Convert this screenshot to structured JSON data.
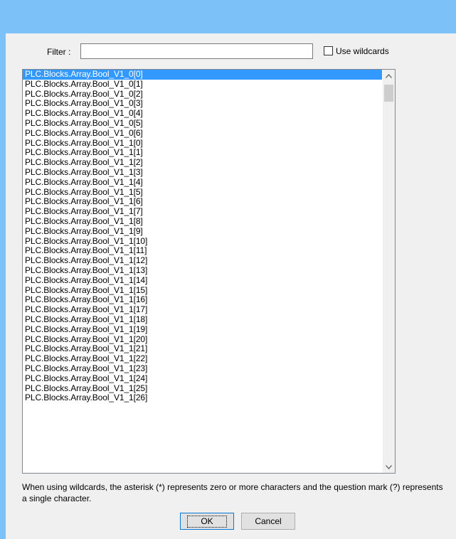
{
  "filter": {
    "label": "Filter :",
    "value": "",
    "placeholder": "",
    "wildcards_label": "Use wildcards",
    "wildcards_checked": false
  },
  "list": {
    "selected_index": 0,
    "items": [
      "PLC.Blocks.Array.Bool_V1_0[0]",
      "PLC.Blocks.Array.Bool_V1_0[1]",
      "PLC.Blocks.Array.Bool_V1_0[2]",
      "PLC.Blocks.Array.Bool_V1_0[3]",
      "PLC.Blocks.Array.Bool_V1_0[4]",
      "PLC.Blocks.Array.Bool_V1_0[5]",
      "PLC.Blocks.Array.Bool_V1_0[6]",
      "PLC.Blocks.Array.Bool_V1_1[0]",
      "PLC.Blocks.Array.Bool_V1_1[1]",
      "PLC.Blocks.Array.Bool_V1_1[2]",
      "PLC.Blocks.Array.Bool_V1_1[3]",
      "PLC.Blocks.Array.Bool_V1_1[4]",
      "PLC.Blocks.Array.Bool_V1_1[5]",
      "PLC.Blocks.Array.Bool_V1_1[6]",
      "PLC.Blocks.Array.Bool_V1_1[7]",
      "PLC.Blocks.Array.Bool_V1_1[8]",
      "PLC.Blocks.Array.Bool_V1_1[9]",
      "PLC.Blocks.Array.Bool_V1_1[10]",
      "PLC.Blocks.Array.Bool_V1_1[11]",
      "PLC.Blocks.Array.Bool_V1_1[12]",
      "PLC.Blocks.Array.Bool_V1_1[13]",
      "PLC.Blocks.Array.Bool_V1_1[14]",
      "PLC.Blocks.Array.Bool_V1_1[15]",
      "PLC.Blocks.Array.Bool_V1_1[16]",
      "PLC.Blocks.Array.Bool_V1_1[17]",
      "PLC.Blocks.Array.Bool_V1_1[18]",
      "PLC.Blocks.Array.Bool_V1_1[19]",
      "PLC.Blocks.Array.Bool_V1_1[20]",
      "PLC.Blocks.Array.Bool_V1_1[21]",
      "PLC.Blocks.Array.Bool_V1_1[22]",
      "PLC.Blocks.Array.Bool_V1_1[23]",
      "PLC.Blocks.Array.Bool_V1_1[24]",
      "PLC.Blocks.Array.Bool_V1_1[25]",
      "PLC.Blocks.Array.Bool_V1_1[26]"
    ]
  },
  "scrollbar": {
    "up_icon": "chevron-up-icon",
    "down_icon": "chevron-down-icon"
  },
  "hint": "When using wildcards, the asterisk (*) represents zero or more characters and the question mark (?) represents a single character.",
  "buttons": {
    "ok_label": "OK",
    "cancel_label": "Cancel"
  },
  "colors": {
    "title_bar": "#7cc2f9",
    "selection": "#3399ff",
    "dialog_bg": "#f0f0f0"
  }
}
